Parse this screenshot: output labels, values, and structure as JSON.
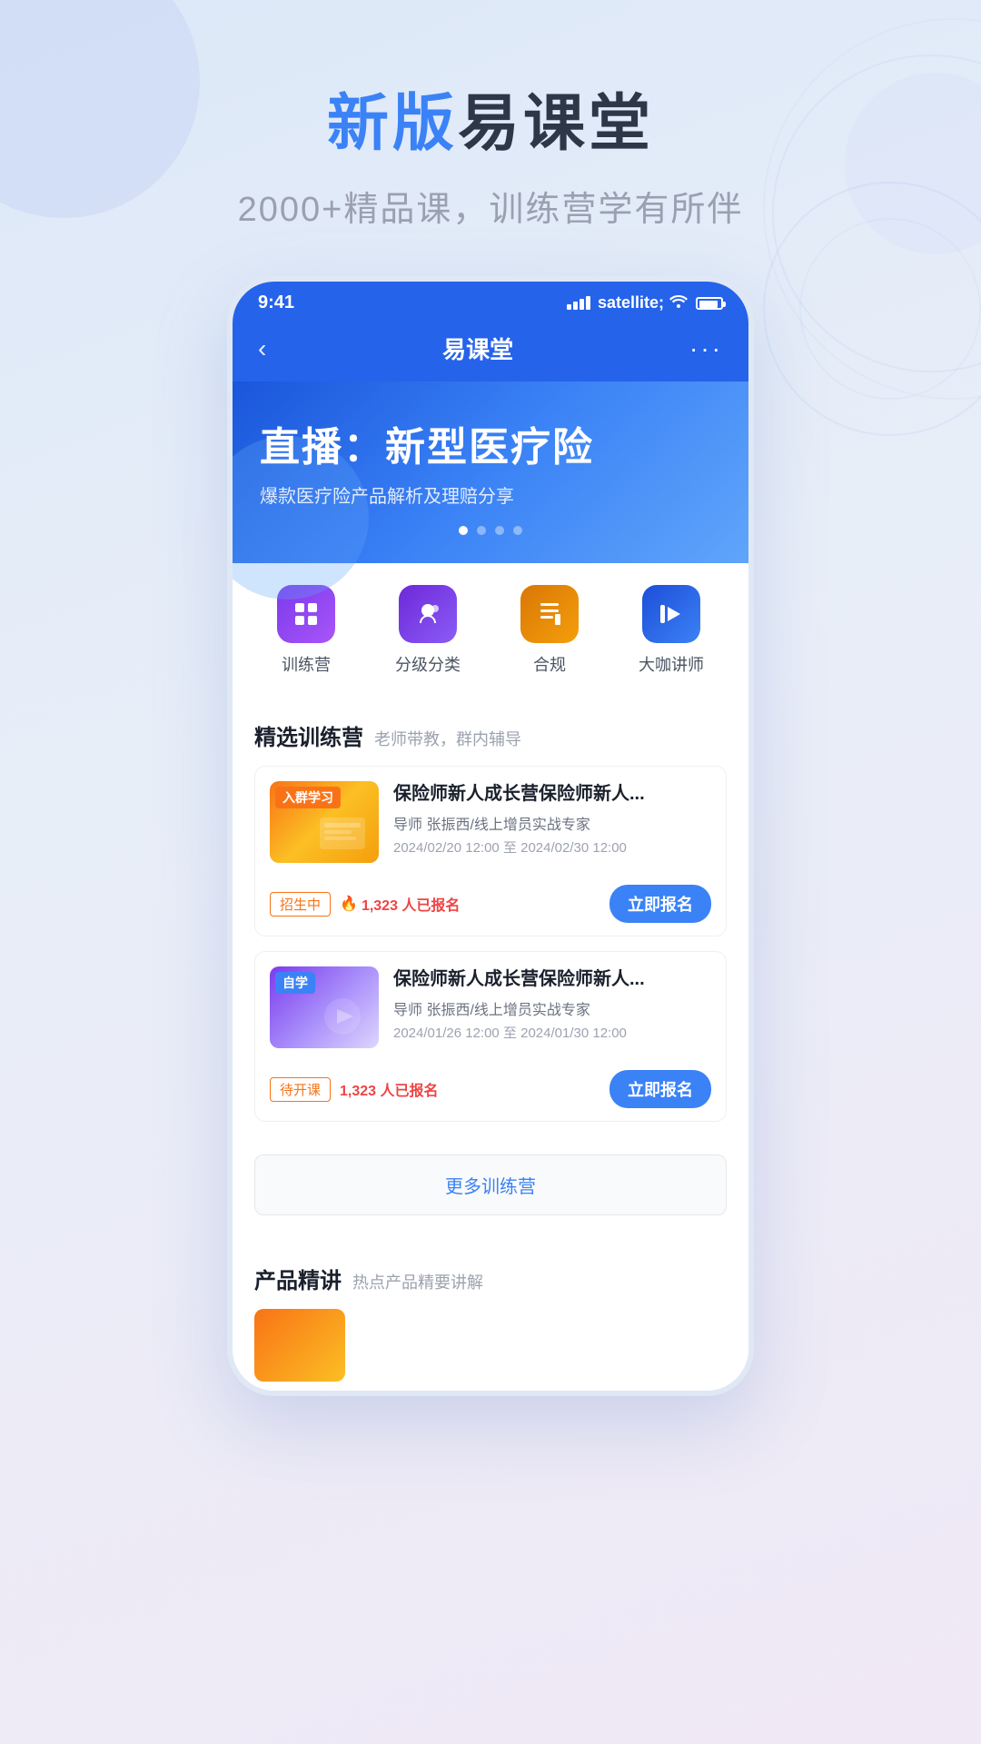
{
  "header": {
    "title_highlight": "新版",
    "title_normal": "易课堂",
    "subtitle": "2000+精品课，训练营学有所伴"
  },
  "phone": {
    "status_bar": {
      "time": "9:41"
    },
    "nav": {
      "back_icon": "‹",
      "title": "易课堂",
      "more_icon": "···"
    },
    "banner": {
      "title": "直播：新型医疗险",
      "subtitle": "爆款医疗险产品解析及理赔分享",
      "dots": [
        true,
        false,
        false,
        false
      ]
    },
    "quick_nav": [
      {
        "label": "训练营",
        "icon_type": "purple"
      },
      {
        "label": "分级分类",
        "icon_type": "violet"
      },
      {
        "label": "合规",
        "icon_type": "orange"
      },
      {
        "label": "大咖讲师",
        "icon_type": "blue"
      }
    ],
    "featured_section": {
      "title": "精选训练营",
      "subtitle": "老师带教，群内辅导",
      "courses": [
        {
          "id": 1,
          "name": "保险师新人成长营保险师新人...",
          "teacher": "导师 张振西/线上增员实战专家",
          "date_start": "2024/02/20 12:00",
          "date_end": "2024/02/30 12:00",
          "status_tag": "招生中",
          "enrolled": "1,323",
          "thumb_type": "1",
          "badge": "入群学习"
        },
        {
          "id": 2,
          "name": "保险师新人成长营保险师新人...",
          "teacher": "导师 张振西/线上增员实战专家",
          "date_start": "2024/01/26 12:00",
          "date_end": "2024/01/30 12:00",
          "status_tag": "待开课",
          "enrolled": "1,323",
          "thumb_type": "2",
          "badge": "自学"
        }
      ],
      "more_btn_label": "更多训练营"
    },
    "product_section": {
      "title": "产品精讲",
      "subtitle": "热点产品精要讲解"
    },
    "register_btn_label": "立即报名",
    "enrolled_label": "人已报名"
  }
}
